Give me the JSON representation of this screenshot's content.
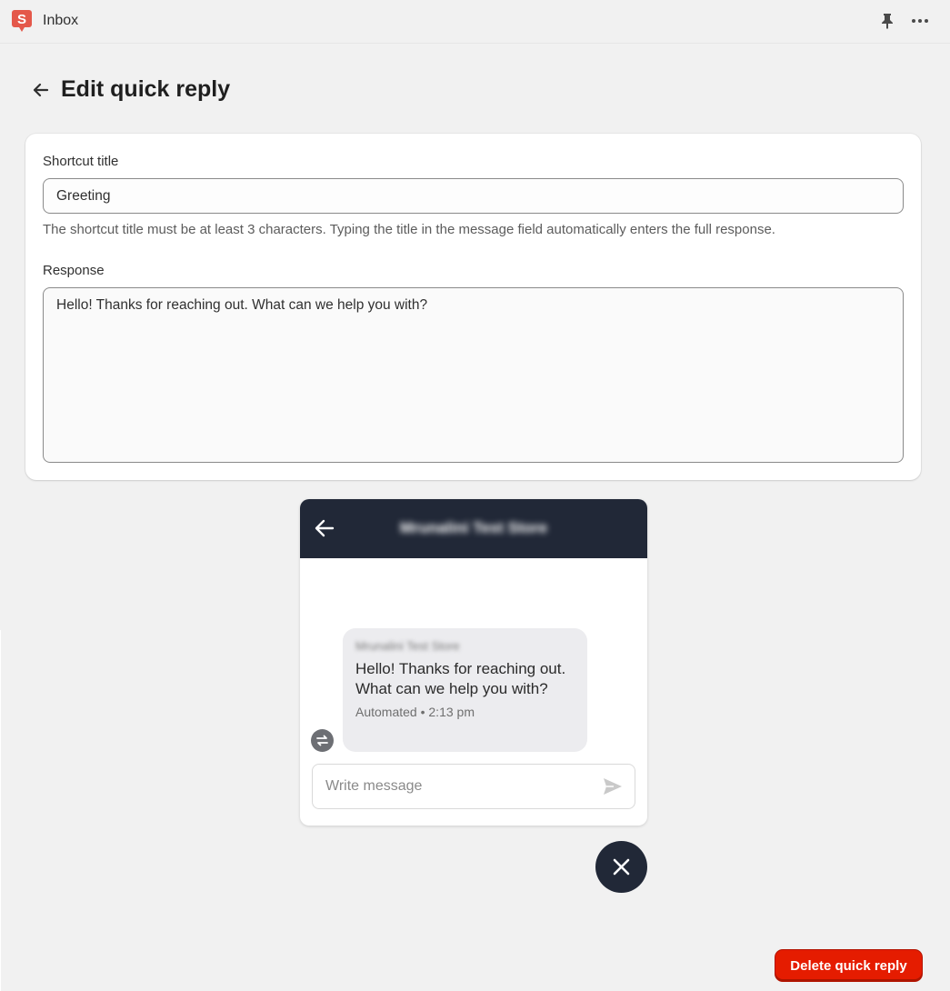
{
  "app": {
    "title": "Inbox",
    "logo_icon": "shopify-inbox-logo-icon",
    "logo_letter": "S",
    "brand_color": "#e4584a"
  },
  "header": {
    "pin_icon": "pin-icon",
    "more_icon": "more-horizontal-icon"
  },
  "page": {
    "title": "Edit quick reply",
    "back_icon": "arrow-left-icon"
  },
  "form": {
    "shortcut_title_label": "Shortcut title",
    "shortcut_title_value": "Greeting",
    "shortcut_help": "The shortcut title must be at least 3 characters. Typing the title in the message field automatically enters the full response.",
    "response_label": "Response",
    "response_value": "Hello! Thanks for reaching out. What can we help you with?"
  },
  "preview": {
    "store_name": "Mrunalini Test Store",
    "header_color": "#212837",
    "message": {
      "sender": "Mrunalini Test Store",
      "text": "Hello! Thanks for reaching out. What can we help you with?",
      "meta": "Automated • 2:13 pm",
      "automated_icon": "automation-swap-icon"
    },
    "compose_placeholder": "Write message",
    "send_icon": "send-icon"
  },
  "close_button": {
    "icon": "close-icon"
  },
  "actions": {
    "delete_label": "Delete quick reply",
    "delete_color": "#e51c00"
  }
}
